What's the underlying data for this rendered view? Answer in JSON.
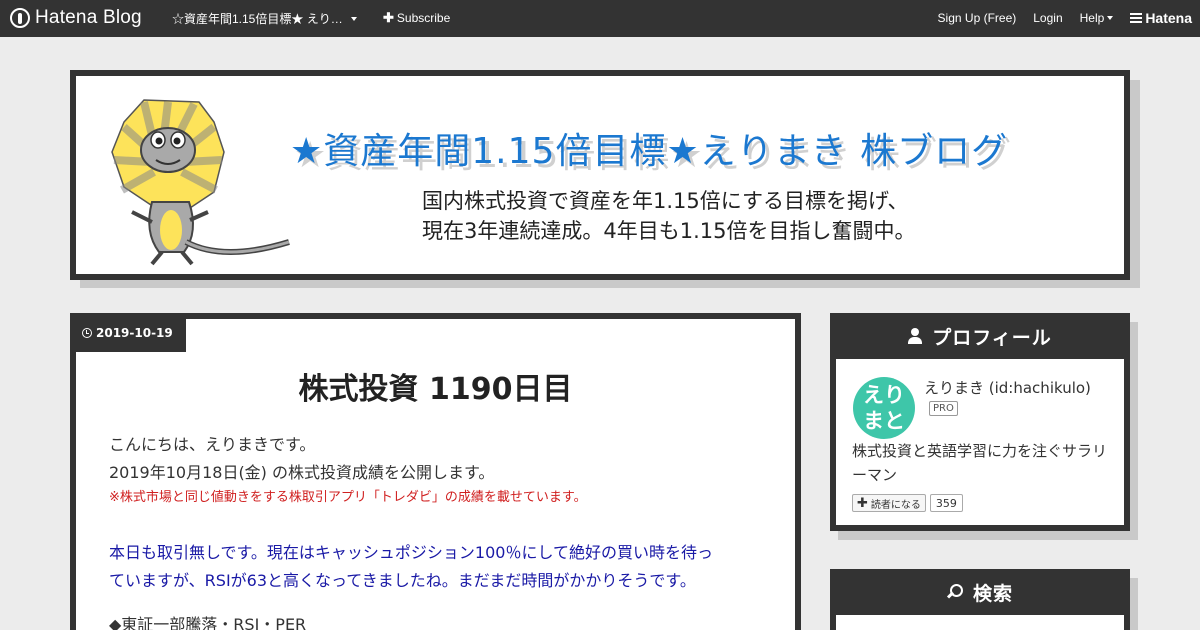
{
  "topbar": {
    "logo_text": "Hatena Blog",
    "blog_select": "☆資産年間1.15倍目標★ えり…",
    "subscribe": "Subscribe",
    "signup": "Sign Up (Free)",
    "login": "Login",
    "help": "Help",
    "hatena": "Hatena"
  },
  "banner": {
    "title": "★資産年間1.15倍目標★えりまき 株ブログ",
    "desc_line1": "国内株式投資で資産を年1.15倍にする目標を掲げ、",
    "desc_line2": "現在3年連続達成。4年目も1.15倍を目指し奮闘中。"
  },
  "article": {
    "date": "2019-10-19",
    "title": "株式投資 1190日目",
    "line1": "こんにちは、えりまきです。",
    "line2": "2019年10月18日(金) の株式投資成績を公開します。",
    "note": "※株式市場と同じ値動きをする株取引アプリ「トレダビ」の成績を載せています。",
    "blue_line1": "本日も取引無しです。現在はキャッシュポジション100％にして絶好の買い時を待っ",
    "blue_line2": "ていますが、RSIが63と高くなってきましたね。まだまだ時間がかかりそうです。",
    "next_heading": "◆東証一部騰落・RSI・PER"
  },
  "profile": {
    "title": "プロフィール",
    "avatar_line1": "えり",
    "avatar_line2": "まと",
    "name": "えりまき (id:hachikulo)",
    "badge": "PRO",
    "desc": "株式投資と英語学習に力を注ぐサラリーマン",
    "reader_label": "読者になる",
    "reader_count": "359"
  },
  "search": {
    "title": "検索"
  },
  "colors": {
    "accent_blue": "#1b78d0",
    "dark": "#333333",
    "note_red": "#d02020",
    "text_blue": "#1a1aa6",
    "avatar_green": "#3ec6a9"
  }
}
